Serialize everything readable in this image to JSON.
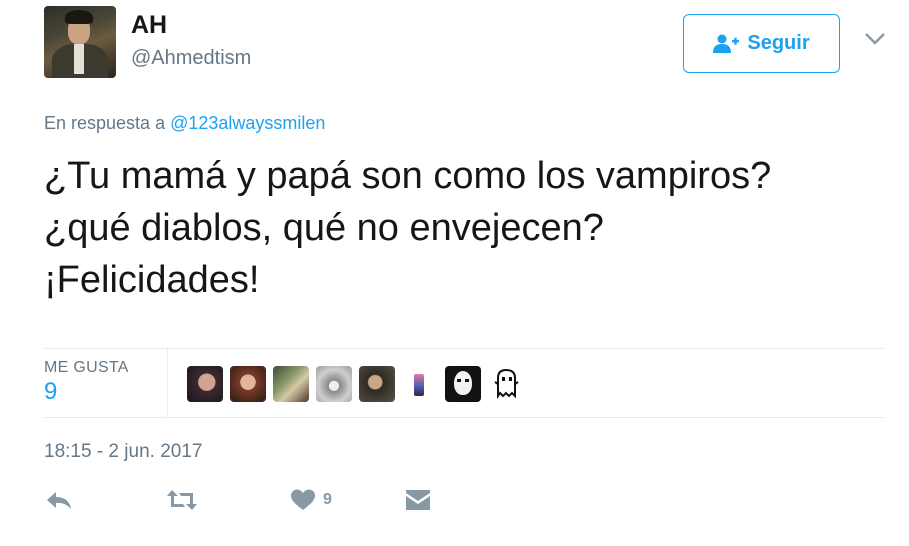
{
  "author": {
    "name": "AH",
    "handle": "@Ahmedtism"
  },
  "follow_button": {
    "label": "Seguir",
    "icon": "follow-person-icon"
  },
  "reply_to": {
    "prefix": "En respuesta a",
    "mention": "@123alwayssmilen"
  },
  "tweet": {
    "lines": [
      "¿Tu mamá y papá son como los vampiros?",
      "¿qué diablos, qué no envejecen?",
      "¡Felicidades!"
    ]
  },
  "stats": {
    "likes_label": "ME GUSTA",
    "likes_count": "9"
  },
  "timestamp": "18:15 - 2 jun. 2017",
  "actions": {
    "like_count": "9",
    "icons": [
      "reply-icon",
      "retweet-icon",
      "heart-icon",
      "direct-message-icon"
    ]
  },
  "colors": {
    "accent": "#1da1f2",
    "muted": "#657786",
    "icon": "#8899a6"
  }
}
